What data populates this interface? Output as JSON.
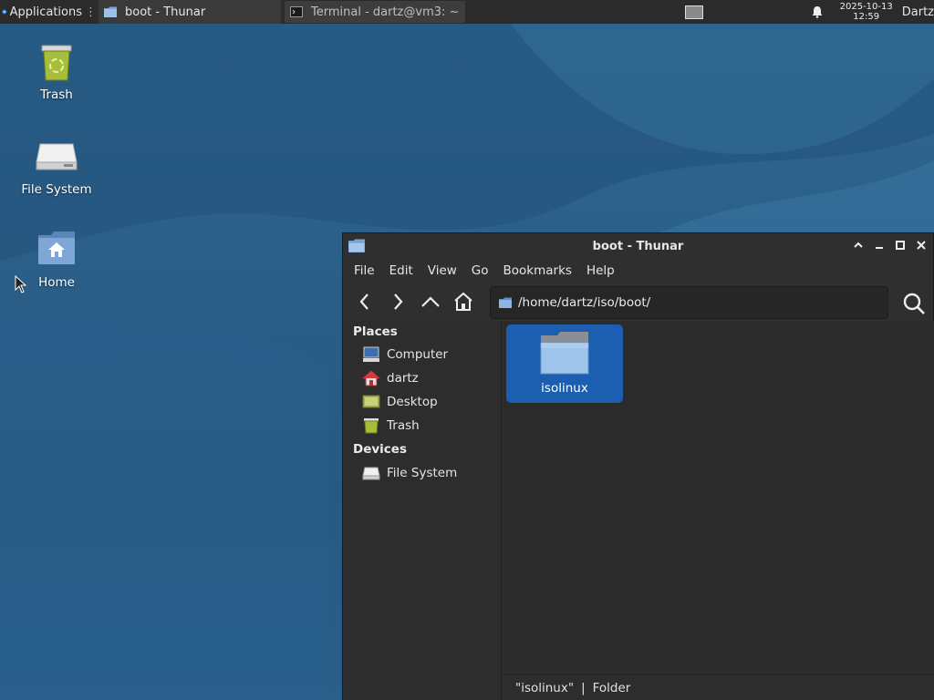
{
  "panel": {
    "applications_label": "Applications",
    "tasks": [
      {
        "label": "boot - Thunar",
        "active": true
      },
      {
        "label": "Terminal - dartz@vm3: ~",
        "active": false
      }
    ],
    "clock_date": "2025-10-13",
    "clock_time": "12:59",
    "user": "Dartz"
  },
  "desktop": {
    "icons": [
      {
        "label": "Trash",
        "icon": "trash-icon"
      },
      {
        "label": "File System",
        "icon": "drive-icon"
      },
      {
        "label": "Home",
        "icon": "home-folder-icon"
      }
    ],
    "background_color": "#2a5e87"
  },
  "window": {
    "title": "boot - Thunar",
    "menu": [
      "File",
      "Edit",
      "View",
      "Go",
      "Bookmarks",
      "Help"
    ],
    "location": "/home/dartz/iso/boot/",
    "sidebar": {
      "places_label": "Places",
      "places": [
        {
          "label": "Computer",
          "icon": "computer-icon"
        },
        {
          "label": "dartz",
          "icon": "user-home-icon"
        },
        {
          "label": "Desktop",
          "icon": "desktop-icon"
        },
        {
          "label": "Trash",
          "icon": "trash-icon"
        }
      ],
      "devices_label": "Devices",
      "devices": [
        {
          "label": "File System",
          "icon": "drive-icon"
        }
      ]
    },
    "items": [
      {
        "label": "isolinux",
        "icon": "folder-icon",
        "selected": true
      }
    ],
    "status": {
      "name": "\"isolinux\"",
      "separator": "|",
      "type": "Folder"
    },
    "selection_color": "#1c5fb0"
  }
}
